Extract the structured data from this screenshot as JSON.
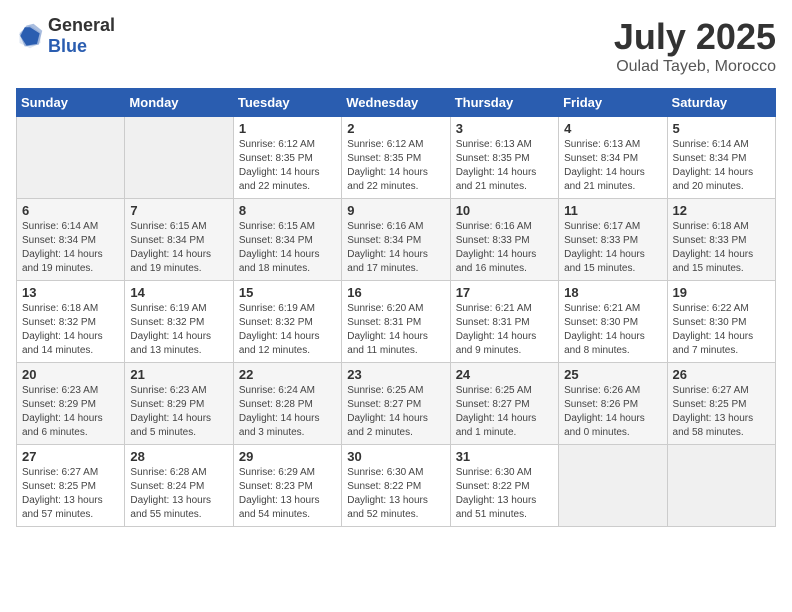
{
  "logo": {
    "text_general": "General",
    "text_blue": "Blue"
  },
  "title": "July 2025",
  "location": "Oulad Tayeb, Morocco",
  "weekdays": [
    "Sunday",
    "Monday",
    "Tuesday",
    "Wednesday",
    "Thursday",
    "Friday",
    "Saturday"
  ],
  "weeks": [
    [
      {
        "day": "",
        "info": ""
      },
      {
        "day": "",
        "info": ""
      },
      {
        "day": "1",
        "info": "Sunrise: 6:12 AM\nSunset: 8:35 PM\nDaylight: 14 hours and 22 minutes."
      },
      {
        "day": "2",
        "info": "Sunrise: 6:12 AM\nSunset: 8:35 PM\nDaylight: 14 hours and 22 minutes."
      },
      {
        "day": "3",
        "info": "Sunrise: 6:13 AM\nSunset: 8:35 PM\nDaylight: 14 hours and 21 minutes."
      },
      {
        "day": "4",
        "info": "Sunrise: 6:13 AM\nSunset: 8:34 PM\nDaylight: 14 hours and 21 minutes."
      },
      {
        "day": "5",
        "info": "Sunrise: 6:14 AM\nSunset: 8:34 PM\nDaylight: 14 hours and 20 minutes."
      }
    ],
    [
      {
        "day": "6",
        "info": "Sunrise: 6:14 AM\nSunset: 8:34 PM\nDaylight: 14 hours and 19 minutes."
      },
      {
        "day": "7",
        "info": "Sunrise: 6:15 AM\nSunset: 8:34 PM\nDaylight: 14 hours and 19 minutes."
      },
      {
        "day": "8",
        "info": "Sunrise: 6:15 AM\nSunset: 8:34 PM\nDaylight: 14 hours and 18 minutes."
      },
      {
        "day": "9",
        "info": "Sunrise: 6:16 AM\nSunset: 8:34 PM\nDaylight: 14 hours and 17 minutes."
      },
      {
        "day": "10",
        "info": "Sunrise: 6:16 AM\nSunset: 8:33 PM\nDaylight: 14 hours and 16 minutes."
      },
      {
        "day": "11",
        "info": "Sunrise: 6:17 AM\nSunset: 8:33 PM\nDaylight: 14 hours and 15 minutes."
      },
      {
        "day": "12",
        "info": "Sunrise: 6:18 AM\nSunset: 8:33 PM\nDaylight: 14 hours and 15 minutes."
      }
    ],
    [
      {
        "day": "13",
        "info": "Sunrise: 6:18 AM\nSunset: 8:32 PM\nDaylight: 14 hours and 14 minutes."
      },
      {
        "day": "14",
        "info": "Sunrise: 6:19 AM\nSunset: 8:32 PM\nDaylight: 14 hours and 13 minutes."
      },
      {
        "day": "15",
        "info": "Sunrise: 6:19 AM\nSunset: 8:32 PM\nDaylight: 14 hours and 12 minutes."
      },
      {
        "day": "16",
        "info": "Sunrise: 6:20 AM\nSunset: 8:31 PM\nDaylight: 14 hours and 11 minutes."
      },
      {
        "day": "17",
        "info": "Sunrise: 6:21 AM\nSunset: 8:31 PM\nDaylight: 14 hours and 9 minutes."
      },
      {
        "day": "18",
        "info": "Sunrise: 6:21 AM\nSunset: 8:30 PM\nDaylight: 14 hours and 8 minutes."
      },
      {
        "day": "19",
        "info": "Sunrise: 6:22 AM\nSunset: 8:30 PM\nDaylight: 14 hours and 7 minutes."
      }
    ],
    [
      {
        "day": "20",
        "info": "Sunrise: 6:23 AM\nSunset: 8:29 PM\nDaylight: 14 hours and 6 minutes."
      },
      {
        "day": "21",
        "info": "Sunrise: 6:23 AM\nSunset: 8:29 PM\nDaylight: 14 hours and 5 minutes."
      },
      {
        "day": "22",
        "info": "Sunrise: 6:24 AM\nSunset: 8:28 PM\nDaylight: 14 hours and 3 minutes."
      },
      {
        "day": "23",
        "info": "Sunrise: 6:25 AM\nSunset: 8:27 PM\nDaylight: 14 hours and 2 minutes."
      },
      {
        "day": "24",
        "info": "Sunrise: 6:25 AM\nSunset: 8:27 PM\nDaylight: 14 hours and 1 minute."
      },
      {
        "day": "25",
        "info": "Sunrise: 6:26 AM\nSunset: 8:26 PM\nDaylight: 14 hours and 0 minutes."
      },
      {
        "day": "26",
        "info": "Sunrise: 6:27 AM\nSunset: 8:25 PM\nDaylight: 13 hours and 58 minutes."
      }
    ],
    [
      {
        "day": "27",
        "info": "Sunrise: 6:27 AM\nSunset: 8:25 PM\nDaylight: 13 hours and 57 minutes."
      },
      {
        "day": "28",
        "info": "Sunrise: 6:28 AM\nSunset: 8:24 PM\nDaylight: 13 hours and 55 minutes."
      },
      {
        "day": "29",
        "info": "Sunrise: 6:29 AM\nSunset: 8:23 PM\nDaylight: 13 hours and 54 minutes."
      },
      {
        "day": "30",
        "info": "Sunrise: 6:30 AM\nSunset: 8:22 PM\nDaylight: 13 hours and 52 minutes."
      },
      {
        "day": "31",
        "info": "Sunrise: 6:30 AM\nSunset: 8:22 PM\nDaylight: 13 hours and 51 minutes."
      },
      {
        "day": "",
        "info": ""
      },
      {
        "day": "",
        "info": ""
      }
    ]
  ]
}
